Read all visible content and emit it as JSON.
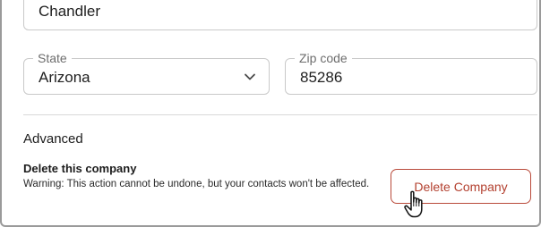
{
  "address": {
    "city_value": "Chandler",
    "state_label": "State",
    "state_value": "Arizona",
    "zip_label": "Zip code",
    "zip_value": "85286"
  },
  "advanced": {
    "title": "Advanced",
    "delete_title": "Delete this company",
    "delete_warning": "Warning: This action cannot be undone, but your contacts won't be affected.",
    "delete_button_label": "Delete Company"
  },
  "icons": {
    "state_dropdown": "chevron-down-icon",
    "pointer": "hand-pointer-cursor-icon"
  },
  "colors": {
    "danger": "#b3402f",
    "field_border": "#c9c9c9"
  }
}
